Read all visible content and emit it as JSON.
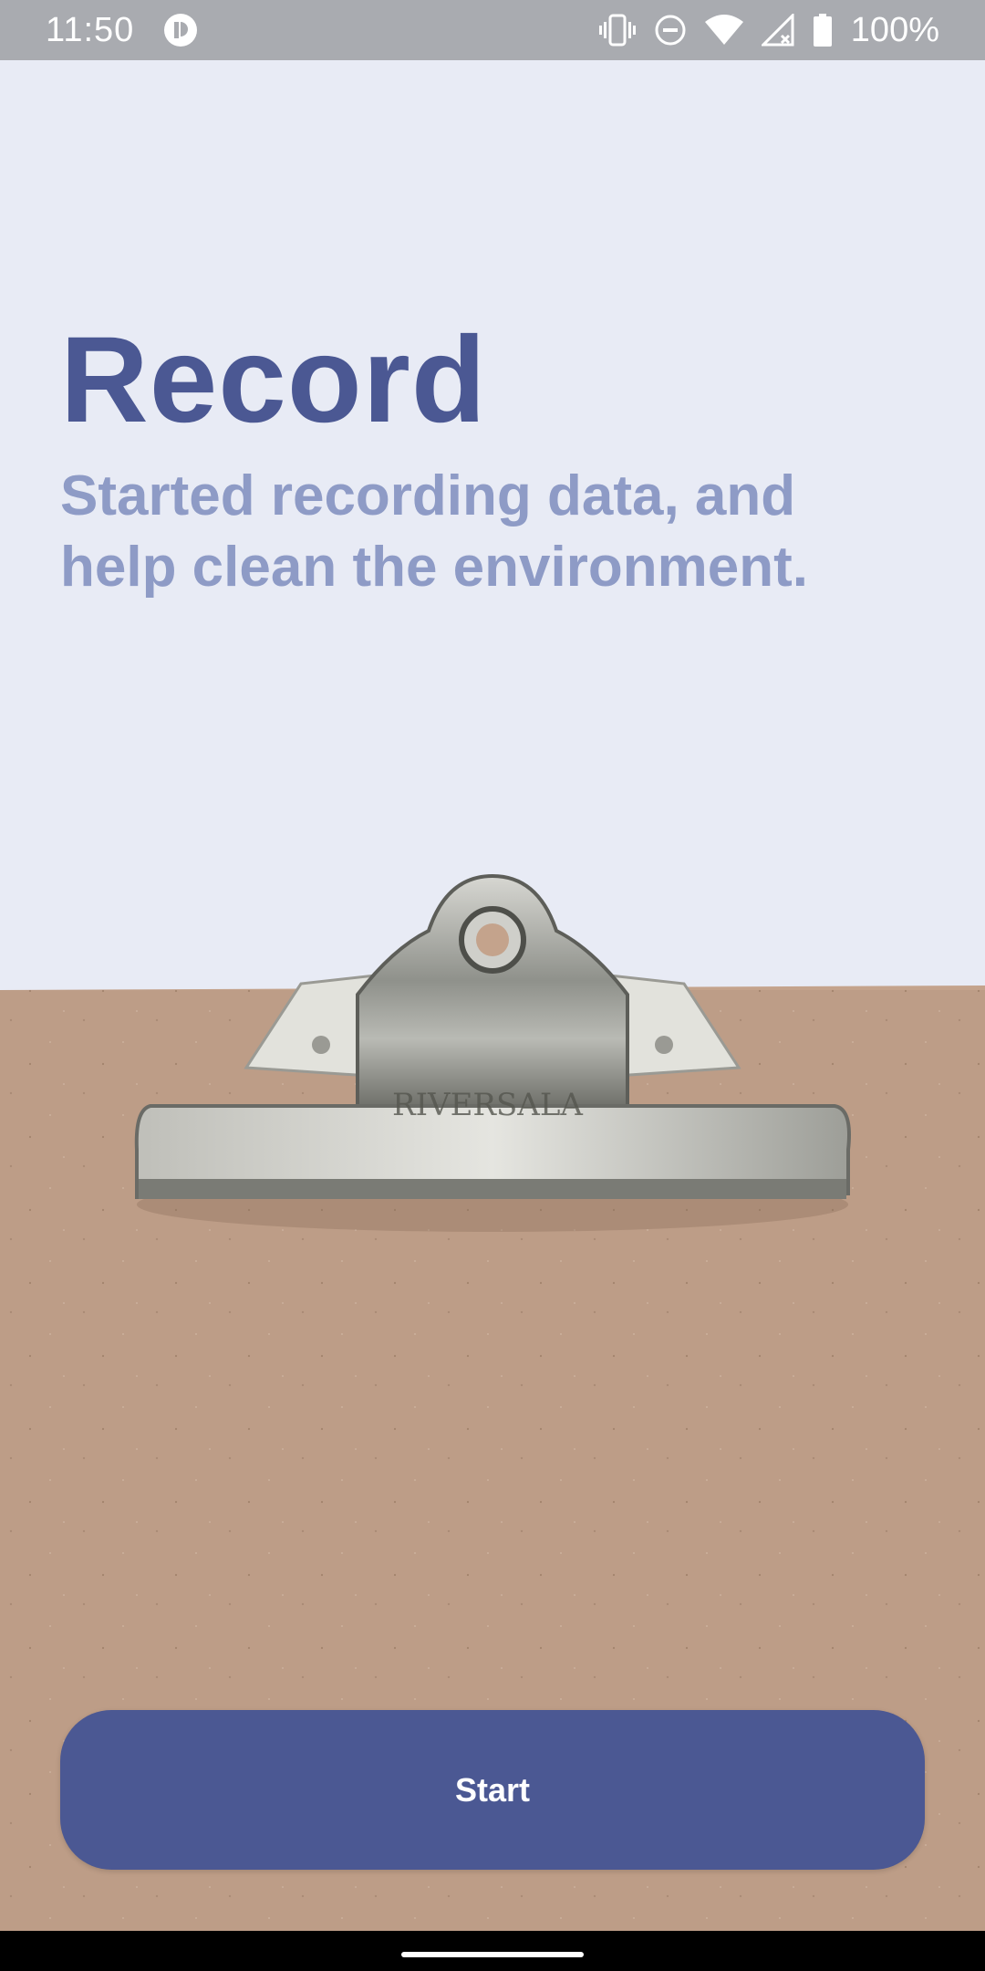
{
  "status_bar": {
    "time": "11:50",
    "app_icon": "notification-badge-icon",
    "battery_percent": "100%",
    "icons": [
      "vibrate-icon",
      "do-not-disturb-icon",
      "wifi-icon",
      "signal-icon",
      "battery-icon"
    ]
  },
  "hero": {
    "title": "Record",
    "subtitle": "Started recording data, and help clean the environment."
  },
  "illustration": {
    "name": "clipboard-illustration",
    "clip_text": "RIVERSALA"
  },
  "actions": {
    "start_label": "Start"
  },
  "colors": {
    "background": "#e8ebf5",
    "primary": "#4b5893",
    "subtitle": "#8e9bc6",
    "board": "#c4a38c"
  }
}
